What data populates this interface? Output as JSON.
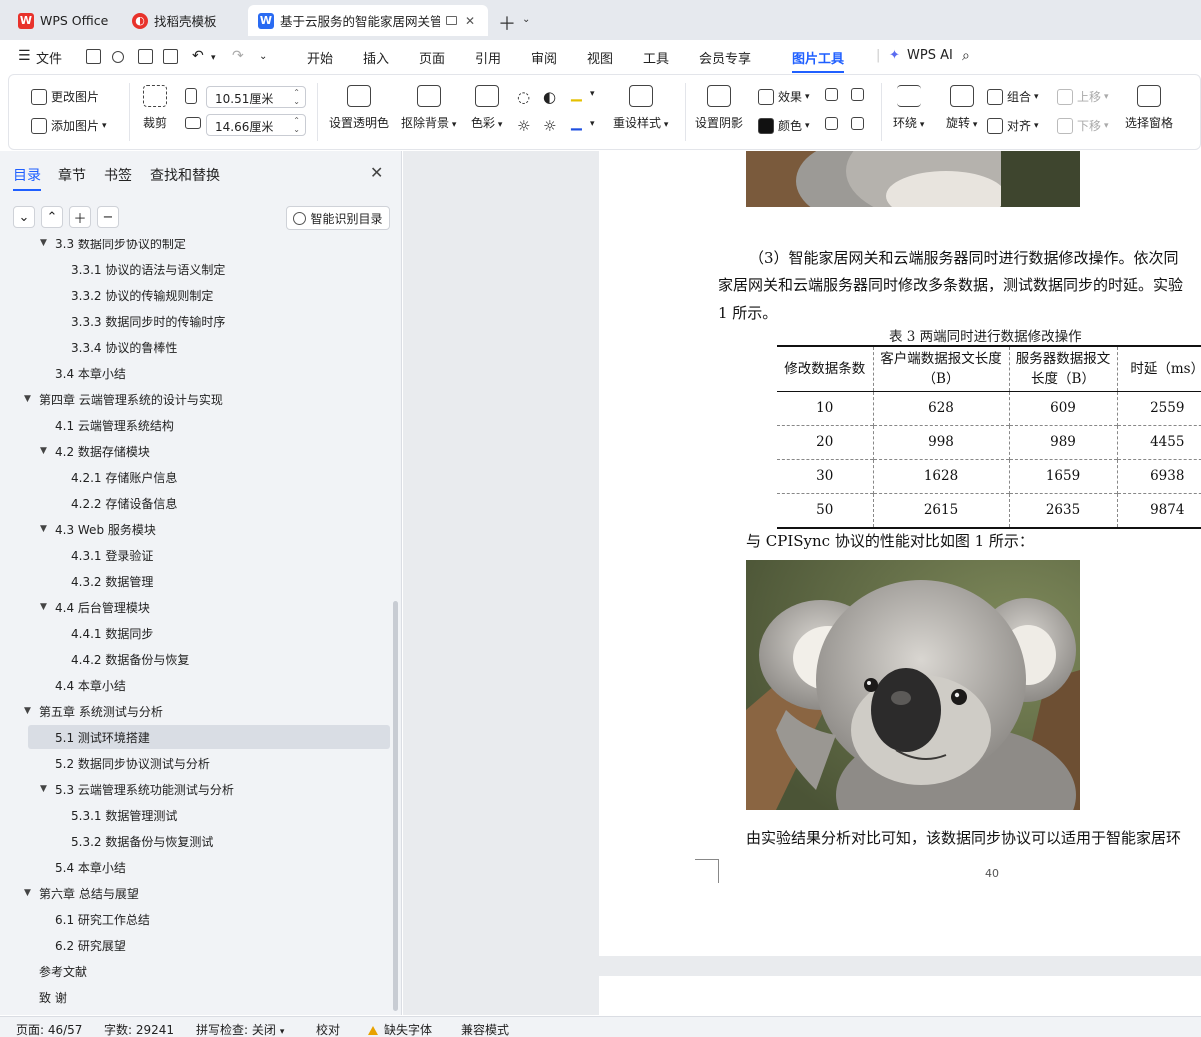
{
  "tabs": [
    {
      "label": "WPS Office"
    },
    {
      "label": "找稻壳模板"
    },
    {
      "label": "基于云服务的智能家居网关管理"
    }
  ],
  "menu": {
    "file": "文件",
    "items": [
      "开始",
      "插入",
      "页面",
      "引用",
      "审阅",
      "视图",
      "工具",
      "会员专享",
      "图片工具"
    ],
    "ai": "WPS AI"
  },
  "ribbon": {
    "change_image": "更改图片",
    "add_image": "添加图片",
    "crop": "裁剪",
    "width": "10.51厘米",
    "height": "14.66厘米",
    "set_transparent": "设置透明色",
    "remove_bg": "抠除背景",
    "color": "色彩",
    "preset_style": "重设样式",
    "set_shadow": "设置阴影",
    "effect": "效果",
    "fill_color": "颜色",
    "wrap": "环绕",
    "rotate": "旋转",
    "group": "组合",
    "align": "对齐",
    "move_up": "上移",
    "move_down": "下移",
    "selection_pane": "选择窗格"
  },
  "sidebar": {
    "tabs": [
      "目录",
      "章节",
      "书签",
      "查找和替换"
    ],
    "smart_toc": "智能识别目录",
    "toc": [
      {
        "label": "3.3 数据同步协议的制定"
      },
      {
        "label": "3.3.1 协议的语法与语义制定"
      },
      {
        "label": "3.3.2 协议的传输规则制定"
      },
      {
        "label": "3.3.3 数据同步时的传输时序"
      },
      {
        "label": "3.3.4 协议的鲁棒性"
      },
      {
        "label": "3.4 本章小结"
      },
      {
        "label": "第四章 云端管理系统的设计与实现"
      },
      {
        "label": "4.1 云端管理系统结构"
      },
      {
        "label": "4.2 数据存储模块"
      },
      {
        "label": "4.2.1 存储账户信息"
      },
      {
        "label": "4.2.2 存储设备信息"
      },
      {
        "label": "4.3 Web 服务模块"
      },
      {
        "label": "4.3.1 登录验证"
      },
      {
        "label": "4.3.2 数据管理"
      },
      {
        "label": "4.4 后台管理模块"
      },
      {
        "label": "4.4.1 数据同步"
      },
      {
        "label": "4.4.2 数据备份与恢复"
      },
      {
        "label": "4.4 本章小结"
      },
      {
        "label": "第五章 系统测试与分析"
      },
      {
        "label": "5.1 测试环境搭建"
      },
      {
        "label": "5.2 数据同步协议测试与分析"
      },
      {
        "label": "5.3 云端管理系统功能测试与分析"
      },
      {
        "label": "5.3.1 数据管理测试"
      },
      {
        "label": "5.3.2 数据备份与恢复测试"
      },
      {
        "label": "5.4 本章小结"
      },
      {
        "label": "第六章 总结与展望"
      },
      {
        "label": "6.1 研究工作总结"
      },
      {
        "label": "6.2 研究展望"
      },
      {
        "label": "参考文献"
      },
      {
        "label": "致 谢"
      }
    ]
  },
  "document": {
    "para1_line1": "（3）智能家居网关和云端服务器同时进行数据修改操作。依次同",
    "para1_line2": "家居网关和云端服务器同时修改多条数据，测试数据同步的时延。实验",
    "para1_line3": "1 所示。",
    "table_caption": "表 3    两端同时进行数据修改操作",
    "table": {
      "headers": [
        "修改数据条数",
        "客户端数据报文长度（B）",
        "服务器数据报文长度（B）",
        "时延（ms）"
      ],
      "rows": [
        [
          "10",
          "628",
          "609",
          "2559"
        ],
        [
          "20",
          "998",
          "989",
          "4455"
        ],
        [
          "30",
          "1628",
          "1659",
          "6938"
        ],
        [
          "50",
          "2615",
          "2635",
          "9874"
        ]
      ]
    },
    "para2": "与 CPISync 协议的性能对比如图 1 所示：",
    "para3": "由实验结果分析对比可知，该数据同步协议可以适用于智能家居环",
    "page_number": "40"
  },
  "status": {
    "page": "页面: 46/57",
    "words": "字数: 29241",
    "spell": "拼写检查: 关闭",
    "proof": "校对",
    "missing_font": "缺失字体",
    "compat": "兼容模式"
  }
}
